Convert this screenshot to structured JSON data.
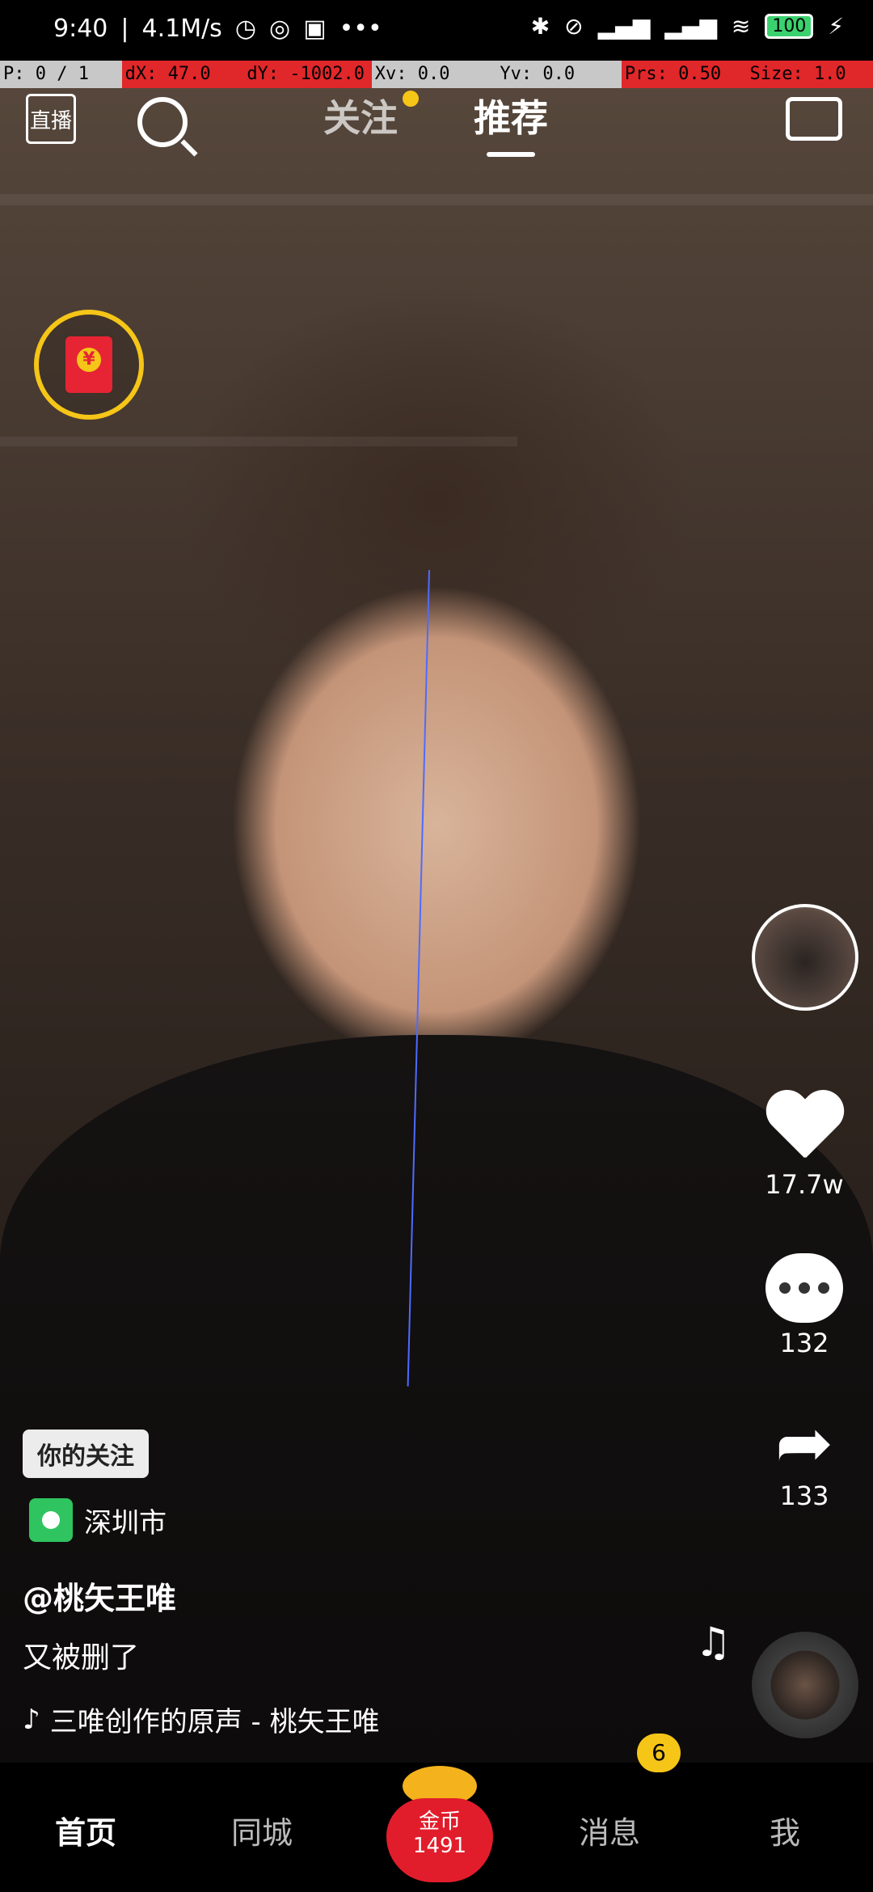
{
  "status_bar": {
    "time": "9:40",
    "speed": "4.1M/s",
    "more": "•••",
    "battery": "100"
  },
  "debug": {
    "p": "P: 0 / 1",
    "dx": "dX: 47.0",
    "dy": "dY: -1002.0",
    "xv": "Xv: 0.0",
    "yv": "Yv: 0.0",
    "prs": "Prs: 0.50",
    "size": "Size: 1.0"
  },
  "top_nav": {
    "live_label": "直播",
    "follow_tab": "关注",
    "recommend_tab": "推荐"
  },
  "sidebar": {
    "likes": "17.7w",
    "comments": "132",
    "shares": "133"
  },
  "info": {
    "follow_badge": "你的关注",
    "location": "深圳市",
    "author": "@桃矢王唯",
    "caption": "又被删了",
    "music": "三唯创作的原声 - 桃矢王唯"
  },
  "bottom_bar": {
    "home": "首页",
    "city": "同城",
    "coin_label": "金币",
    "coin_count": "1491",
    "messages": "消息",
    "messages_badge": "6",
    "me": "我"
  },
  "colors": {
    "accent_yellow": "#f5c518",
    "red": "#e21d2b"
  }
}
